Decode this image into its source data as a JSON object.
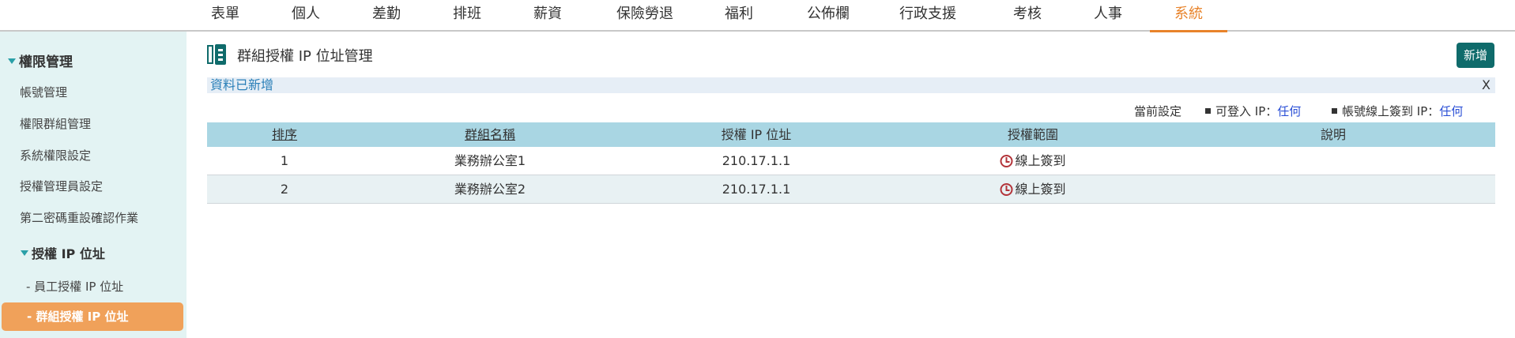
{
  "nav": {
    "items": [
      "表單",
      "個人",
      "差勤",
      "排班",
      "薪資",
      "保險勞退",
      "福利",
      "公佈欄",
      "行政支援",
      "考核",
      "人事",
      "系統"
    ],
    "active_index": 11
  },
  "sidebar": {
    "group_title": "權限管理",
    "items": [
      "帳號管理",
      "權限群組管理",
      "系統權限設定",
      "授權管理員設定",
      "第二密碼重設確認作業"
    ],
    "sub_group": "授權 IP 位址",
    "sub_items": [
      "- 員工授權 IP 位址",
      "- 群組授權 IP 位址"
    ],
    "active_sub_index": 1
  },
  "page": {
    "title": "群組授權 IP 位址管理",
    "add_button": "新增",
    "message": "資料已新增",
    "close_label": "X"
  },
  "settings": {
    "label": "當前設定",
    "login_ip_label": "可登入 IP：",
    "login_ip_value": "任何",
    "signin_ip_label": "帳號線上簽到 IP：",
    "signin_ip_value": "任何"
  },
  "table": {
    "headers": [
      "排序",
      "群組名稱",
      "授權 IP 位址",
      "授權範圍",
      "說明"
    ],
    "rows": [
      {
        "order": "1",
        "group": "業務辦公室1",
        "ip": "210.17.1.1",
        "scope": "線上簽到",
        "note": ""
      },
      {
        "order": "2",
        "group": "業務辦公室2",
        "ip": "210.17.1.1",
        "scope": "線上簽到",
        "note": ""
      }
    ]
  },
  "colors": {
    "accent": "#e8832a",
    "sidebar_bg": "#e3f3f3",
    "active_item_bg": "#f0a15a",
    "add_button_bg": "#0f6b6b",
    "table_header_bg": "#a9d6e3",
    "message_bg": "#e6eef6",
    "message_text": "#2a7fb8",
    "link_blue": "#2a4fd6",
    "clock_red": "#b3343a"
  },
  "icons": {
    "page_icon": "document-panel-icon",
    "scope_icon": "clock-icon",
    "collapse_icon": "caret-down-icon"
  }
}
